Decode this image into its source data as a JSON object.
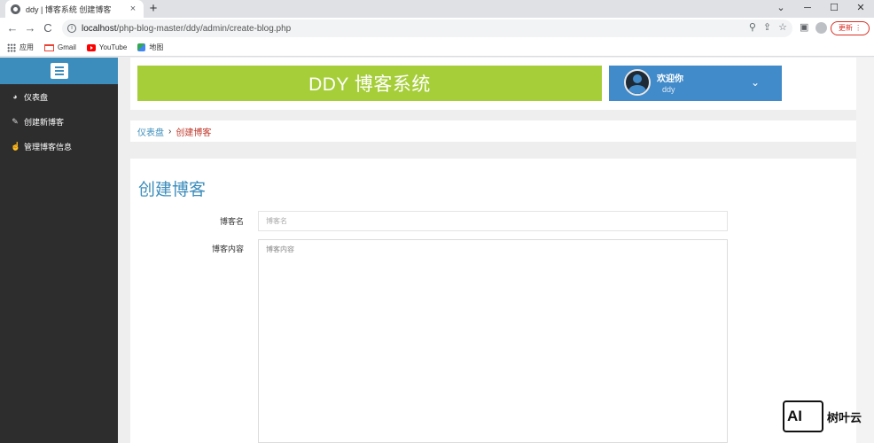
{
  "browser": {
    "tab_title": "ddy | 博客系统 创建博客",
    "tab_close": "×",
    "new_tab": "+",
    "win_controls": [
      "⌄",
      "─",
      "☐",
      "✕"
    ],
    "nav": {
      "back": "←",
      "forward": "→",
      "reload": "C"
    },
    "url_host": "localhost",
    "url_path": "/php-blog-master/ddy/admin/create-blog.php",
    "omnibox_icons": [
      "zoom-icon",
      "share-icon",
      "star-icon"
    ],
    "update_label": "更新 ⋮",
    "bookmarks": [
      {
        "label": "应用",
        "icon": "apps-icon"
      },
      {
        "label": "Gmail",
        "icon": "gmail-icon"
      },
      {
        "label": "YouTube",
        "icon": "youtube-icon"
      },
      {
        "label": "地图",
        "icon": "maps-icon"
      }
    ]
  },
  "sidebar": {
    "items": [
      {
        "label": "仪表盘",
        "icon": "dashboard-icon"
      },
      {
        "label": "创建新博客",
        "icon": "pin-icon"
      },
      {
        "label": "管理博客信息",
        "icon": "thumbs-up-icon"
      }
    ]
  },
  "header": {
    "banner": "DDY 博客系统",
    "welcome": "欢迎你",
    "username": "ddy"
  },
  "breadcrumb": {
    "home": "仪表盘",
    "separator": "›",
    "current": "创建博客"
  },
  "form": {
    "title": "创建博客",
    "name_label": "博客名",
    "name_placeholder": "博客名",
    "content_label": "博客内容",
    "content_placeholder": "博客内容"
  },
  "colors": {
    "sidebar_bg": "#2d2d2d",
    "sidebar_top": "#3c8dbc",
    "banner_bg": "#a6ce39",
    "user_panel_bg": "#428bca",
    "accent": "#3c8dbc"
  },
  "watermark": {
    "logo": "AI",
    "text": "树叶云"
  }
}
